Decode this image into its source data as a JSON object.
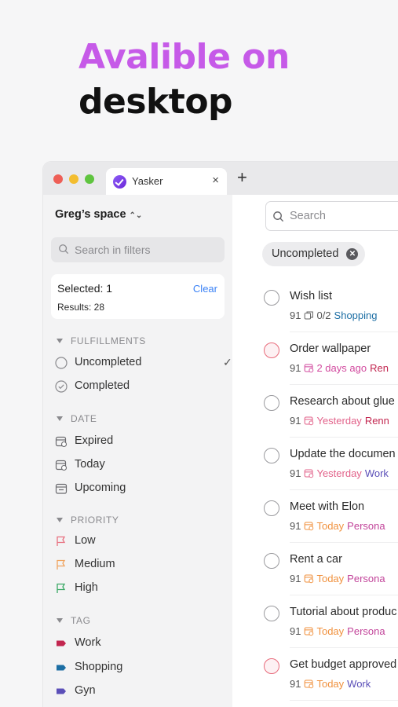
{
  "hero": {
    "line1": "Avalible on",
    "line2": "desktop"
  },
  "browser": {
    "tab_title": "Yasker",
    "tab_close": "×",
    "new_tab": "+"
  },
  "sidebar": {
    "space_name": "Greg’s space",
    "search_placeholder": "Search in filters",
    "selected_label": "Selected: 1",
    "clear_label": "Clear",
    "results_label": "Results: 28",
    "sections": {
      "fulfillments": "FULFILLMENTS",
      "date": "DATE",
      "priority": "PRIORITY",
      "tag": "TAG"
    },
    "fulfillments": [
      {
        "label": "Uncompleted",
        "checked": true
      },
      {
        "label": "Completed",
        "checked": false
      }
    ],
    "dates": [
      {
        "label": "Expired"
      },
      {
        "label": "Today"
      },
      {
        "label": "Upcoming"
      }
    ],
    "priorities": [
      {
        "label": "Low",
        "color": "#e8707f"
      },
      {
        "label": "Medium",
        "color": "#f0a35e"
      },
      {
        "label": "High",
        "color": "#3aa865"
      }
    ],
    "tags": [
      {
        "label": "Work",
        "color": "#c2264f"
      },
      {
        "label": "Shopping",
        "color": "#1c6ea4"
      },
      {
        "label": "Gyn",
        "color": "#5b4fb8"
      }
    ]
  },
  "main": {
    "search_placeholder": "Search",
    "filter_chip": "Uncompleted",
    "tasks": [
      {
        "title": "Wish list",
        "count": "91",
        "sub": "0/2",
        "tag": "Shopping",
        "tag_color": "#1c6ea4",
        "date": "",
        "date_color": "",
        "red": false
      },
      {
        "title": "Order wallpaper",
        "count": "91",
        "date": "2 days ago",
        "date_color": "#d24a9f",
        "tag": "Ren",
        "tag_color": "#c2264f",
        "red": true
      },
      {
        "title": "Research about glue",
        "count": "91",
        "date": "Yesterday",
        "date_color": "#e2628a",
        "tag": "Renn",
        "tag_color": "#c2264f",
        "red": false
      },
      {
        "title": "Update the documen",
        "count": "91",
        "date": "Yesterday",
        "date_color": "#e2628a",
        "tag": "Work",
        "tag_color": "#5b4fb8",
        "red": false
      },
      {
        "title": "Meet with Elon",
        "count": "91",
        "date": "Today",
        "date_color": "#f0913e",
        "tag": "Persona",
        "tag_color": "#c2449a",
        "red": false
      },
      {
        "title": "Rent a car",
        "count": "91",
        "date": "Today",
        "date_color": "#f0913e",
        "tag": "Persona",
        "tag_color": "#c2449a",
        "red": false
      },
      {
        "title": "Tutorial about produc",
        "count": "91",
        "date": "Today",
        "date_color": "#f0913e",
        "tag": "Persona",
        "tag_color": "#c2449a",
        "red": false
      },
      {
        "title": "Get budget approved",
        "count": "91",
        "date": "Today",
        "date_color": "#f0913e",
        "tag": "Work",
        "tag_color": "#5b4fb8",
        "red": true
      }
    ]
  }
}
